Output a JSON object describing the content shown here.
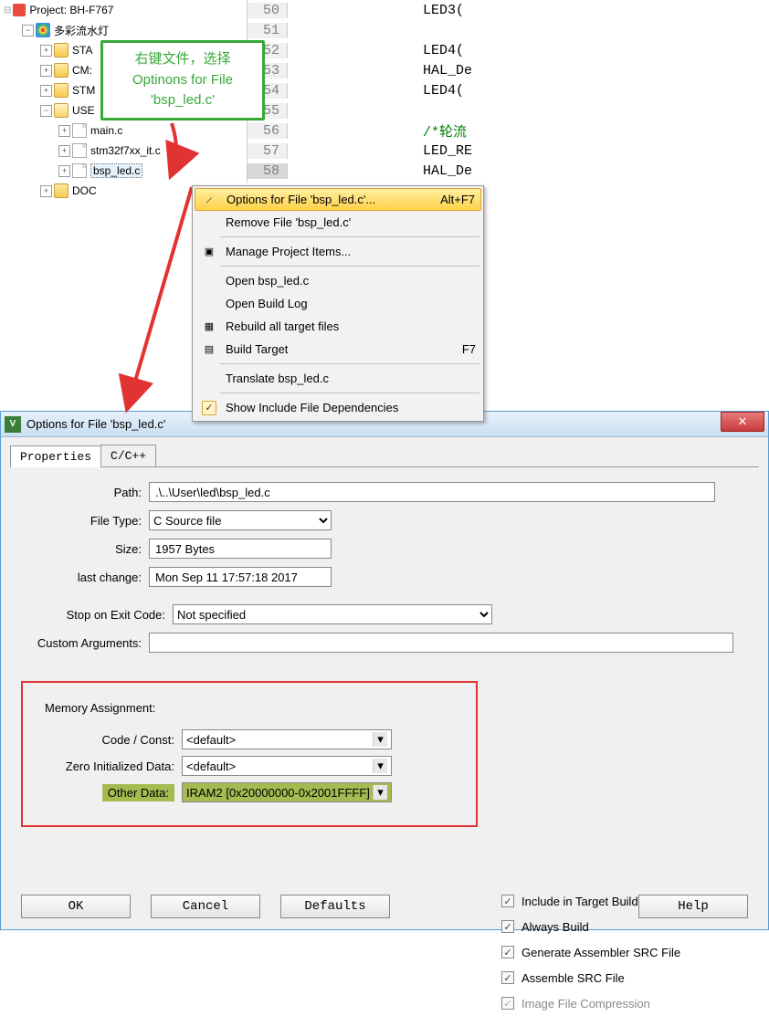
{
  "tree": {
    "project": "Project: BH-F767",
    "group": "多彩流水灯",
    "folders": [
      "STA",
      "CM:",
      "STM"
    ],
    "userFolder": "USE",
    "files": [
      "main.c",
      "stm32f7xx_it.c",
      "bsp_led.c"
    ],
    "doc": "DOC"
  },
  "code": {
    "lines": [
      {
        "n": "50",
        "t": "LED3("
      },
      {
        "n": "51",
        "t": ""
      },
      {
        "n": "52",
        "t": "LED4("
      },
      {
        "n": "53",
        "t": "HAL_De"
      },
      {
        "n": "54",
        "t": "LED4("
      },
      {
        "n": "55",
        "t": ""
      },
      {
        "n": "56",
        "t": "/*轮流",
        "c": true
      },
      {
        "n": "57",
        "t": "LED_RE"
      },
      {
        "n": "58",
        "t": "HAL_De"
      }
    ]
  },
  "callout": {
    "line1": "右键文件，选择",
    "line2": "Optinons for File",
    "line3": "'bsp_led.c'"
  },
  "menu": {
    "items": [
      {
        "label": "Options for File 'bsp_led.c'...",
        "shortcut": "Alt+F7",
        "hl": true,
        "icon": "wand"
      },
      {
        "label": "Remove File 'bsp_led.c'"
      },
      {
        "sep": true
      },
      {
        "label": "Manage Project Items...",
        "icon": "blocks"
      },
      {
        "sep": true
      },
      {
        "label": "Open bsp_led.c"
      },
      {
        "label": "Open Build Log"
      },
      {
        "label": "Rebuild all target files",
        "icon": "rebuild"
      },
      {
        "label": "Build Target",
        "shortcut": "F7",
        "icon": "build"
      },
      {
        "sep": true
      },
      {
        "label": "Translate bsp_led.c"
      },
      {
        "sep": true
      },
      {
        "label": "Show Include File Dependencies",
        "icon": "check"
      }
    ]
  },
  "dialog": {
    "title": "Options for File 'bsp_led.c'",
    "tabs": [
      "Properties",
      "C/C++"
    ],
    "path_label": "Path:",
    "path": ".\\..\\User\\led\\bsp_led.c",
    "filetype_label": "File Type:",
    "filetype": "C Source file",
    "size_label": "Size:",
    "size": "1957 Bytes",
    "lastchange_label": "last change:",
    "lastchange": "Mon Sep 11 17:57:18 2017",
    "stopexit_label": "Stop on Exit Code:",
    "stopexit": "Not specified",
    "customargs_label": "Custom Arguments:",
    "customargs": "",
    "checks": [
      "Include in Target Build",
      "Always Build",
      "Generate Assembler SRC File",
      "Assemble SRC File",
      "Image File Compression"
    ],
    "memory": {
      "title": "Memory Assignment:",
      "code_label": "Code / Const:",
      "code": "<default>",
      "zero_label": "Zero Initialized Data:",
      "zero": "<default>",
      "other_label": "Other Data:",
      "other": "IRAM2 [0x20000000-0x2001FFFF]"
    },
    "buttons": {
      "ok": "OK",
      "cancel": "Cancel",
      "defaults": "Defaults",
      "help": "Help"
    }
  }
}
